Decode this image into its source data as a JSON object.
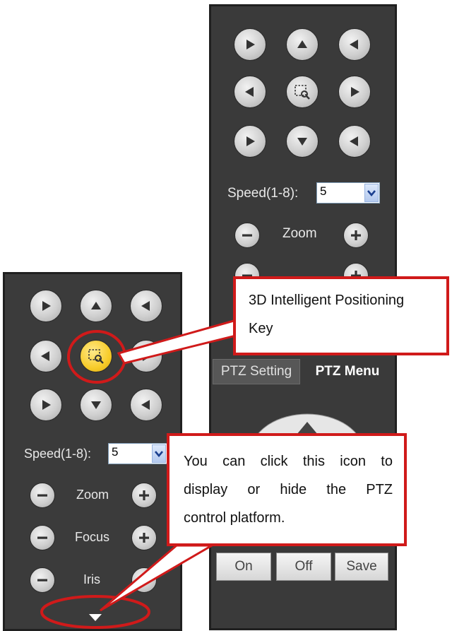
{
  "right_panel": {
    "speed_label": "Speed(1-8):",
    "speed_value": "5",
    "zoom_label": "Zoom",
    "tabs": [
      "PTZ Setting",
      "PTZ Menu"
    ],
    "actions": [
      "On",
      "Off",
      "Save"
    ]
  },
  "left_panel": {
    "speed_label": "Speed(1-8):",
    "speed_value": "5",
    "zoom_label": "Zoom",
    "focus_label": "Focus",
    "iris_label": "Iris"
  },
  "callouts": {
    "positioning": [
      "3D Intelligent Positioning",
      "Key"
    ],
    "toggle": [
      "You can click this icon to",
      "display or hide the PTZ",
      "control platform."
    ]
  },
  "colors": {
    "panel_bg": "#3a3a3a",
    "callout_border": "#d01a1a",
    "positioning_key": "#f7cc2a"
  }
}
